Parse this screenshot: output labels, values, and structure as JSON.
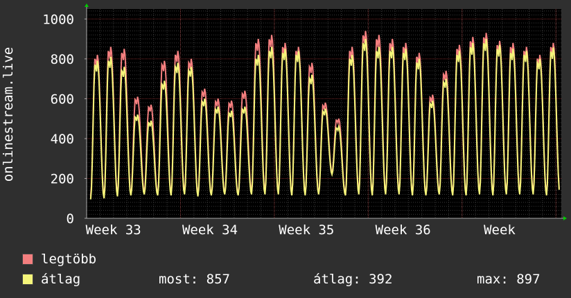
{
  "colors": {
    "background": "#2f2f2f",
    "plot_background": "#000000",
    "grid_minor": "#3a3a3a",
    "grid_major": "#7a2a2a",
    "axis": "#aaaaaa",
    "arrow": "#00cc00",
    "text": "#ffffff",
    "max_series": "#f47f7f",
    "avg_series": "#f5f57a"
  },
  "chart_data": {
    "type": "line",
    "ylabel": "onlinestream.live",
    "ylim": [
      0,
      1050
    ],
    "yticks": [
      0,
      200,
      400,
      600,
      800,
      1000
    ],
    "x_range_days": [
      0,
      35.4
    ],
    "x_tick_days": [
      2.0,
      9.2,
      16.4,
      23.6,
      30.8
    ],
    "x_tick_labels": [
      "Week 33",
      "Week 34",
      "Week 35",
      "Week 36",
      "Week"
    ],
    "grid": true,
    "days": 35,
    "series": [
      {
        "name": "legtöbb",
        "color": "#f47f7f",
        "daily_peaks": [
          820,
          860,
          850,
          610,
          570,
          790,
          840,
          800,
          650,
          600,
          590,
          640,
          900,
          920,
          880,
          860,
          780,
          580,
          500,
          860,
          940,
          920,
          900,
          880,
          830,
          620,
          740,
          870,
          910,
          930,
          890,
          880,
          860,
          820,
          880
        ],
        "daily_troughs": [
          110,
          110,
          120,
          120,
          130,
          120,
          120,
          130,
          120,
          120,
          125,
          120,
          130,
          130,
          125,
          120,
          120,
          125,
          230,
          120,
          130,
          120,
          125,
          130,
          120,
          120,
          130,
          120,
          120,
          130,
          120,
          125,
          130,
          130,
          120
        ]
      },
      {
        "name": "átlag",
        "color": "#f5f57a",
        "daily_peaks": [
          790,
          810,
          760,
          520,
          490,
          690,
          780,
          760,
          600,
          560,
          540,
          560,
          820,
          860,
          850,
          840,
          720,
          550,
          460,
          820,
          900,
          860,
          860,
          850,
          800,
          590,
          700,
          840,
          880,
          900,
          870,
          850,
          840,
          800,
          857
        ],
        "daily_troughs": [
          95,
          100,
          110,
          115,
          120,
          115,
          115,
          120,
          110,
          115,
          120,
          115,
          120,
          120,
          120,
          115,
          115,
          120,
          220,
          115,
          120,
          115,
          120,
          120,
          115,
          115,
          120,
          115,
          115,
          120,
          115,
          120,
          120,
          120,
          115
        ]
      }
    ],
    "legend": [
      {
        "label": "legtöbb",
        "color": "#f47f7f"
      },
      {
        "label": "átlag",
        "color": "#f5f57a"
      }
    ],
    "stats": {
      "most": "most: 857",
      "atlag": "átlag: 392",
      "max": "max: 897"
    }
  }
}
